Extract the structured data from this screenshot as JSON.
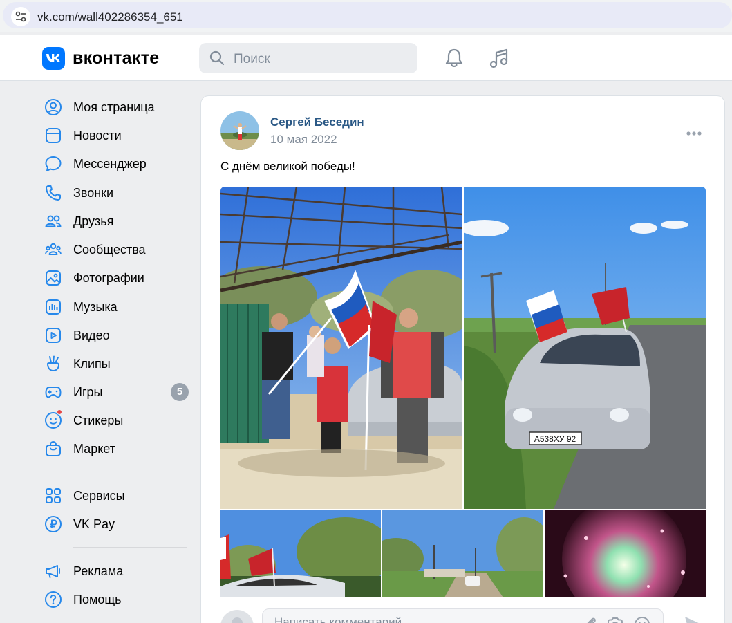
{
  "browser": {
    "url": "vk.com/wall402286354_651"
  },
  "header": {
    "logo_text": "вконтакте",
    "search_placeholder": "Поиск",
    "icons": [
      "bell-icon",
      "music-icon"
    ]
  },
  "sidebar": {
    "items": [
      {
        "label": "Моя страница",
        "icon": "profile-icon"
      },
      {
        "label": "Новости",
        "icon": "news-icon"
      },
      {
        "label": "Мессенджер",
        "icon": "chat-icon"
      },
      {
        "label": "Звонки",
        "icon": "phone-icon"
      },
      {
        "label": "Друзья",
        "icon": "friends-icon"
      },
      {
        "label": "Сообщества",
        "icon": "communities-icon"
      },
      {
        "label": "Фотографии",
        "icon": "photo-icon"
      },
      {
        "label": "Музыка",
        "icon": "music-icon"
      },
      {
        "label": "Видео",
        "icon": "video-icon"
      },
      {
        "label": "Клипы",
        "icon": "clips-icon"
      },
      {
        "label": "Игры",
        "icon": "games-icon",
        "badge": "5"
      },
      {
        "label": "Стикеры",
        "icon": "stickers-icon"
      },
      {
        "label": "Маркет",
        "icon": "market-icon"
      },
      {
        "label": "Сервисы",
        "icon": "services-icon"
      },
      {
        "label": "VK Pay",
        "icon": "vkpay-icon"
      },
      {
        "label": "Реклама",
        "icon": "ads-icon"
      },
      {
        "label": "Помощь",
        "icon": "help-icon"
      }
    ]
  },
  "post": {
    "author": "Сергей Беседин",
    "date": "10 мая 2022",
    "text": "С днём великой победы!",
    "photos": [
      "family-with-flags-photo",
      "car-with-flags-photo",
      "car-roof-flags-photo",
      "road-car-photo",
      "fireworks-photo"
    ],
    "plate": "А538ХУ 92"
  },
  "comment": {
    "placeholder": "Написать комментарий..."
  },
  "colors": {
    "accent": "#0077ff",
    "link": "#2a5885",
    "bg": "#edeef0"
  }
}
